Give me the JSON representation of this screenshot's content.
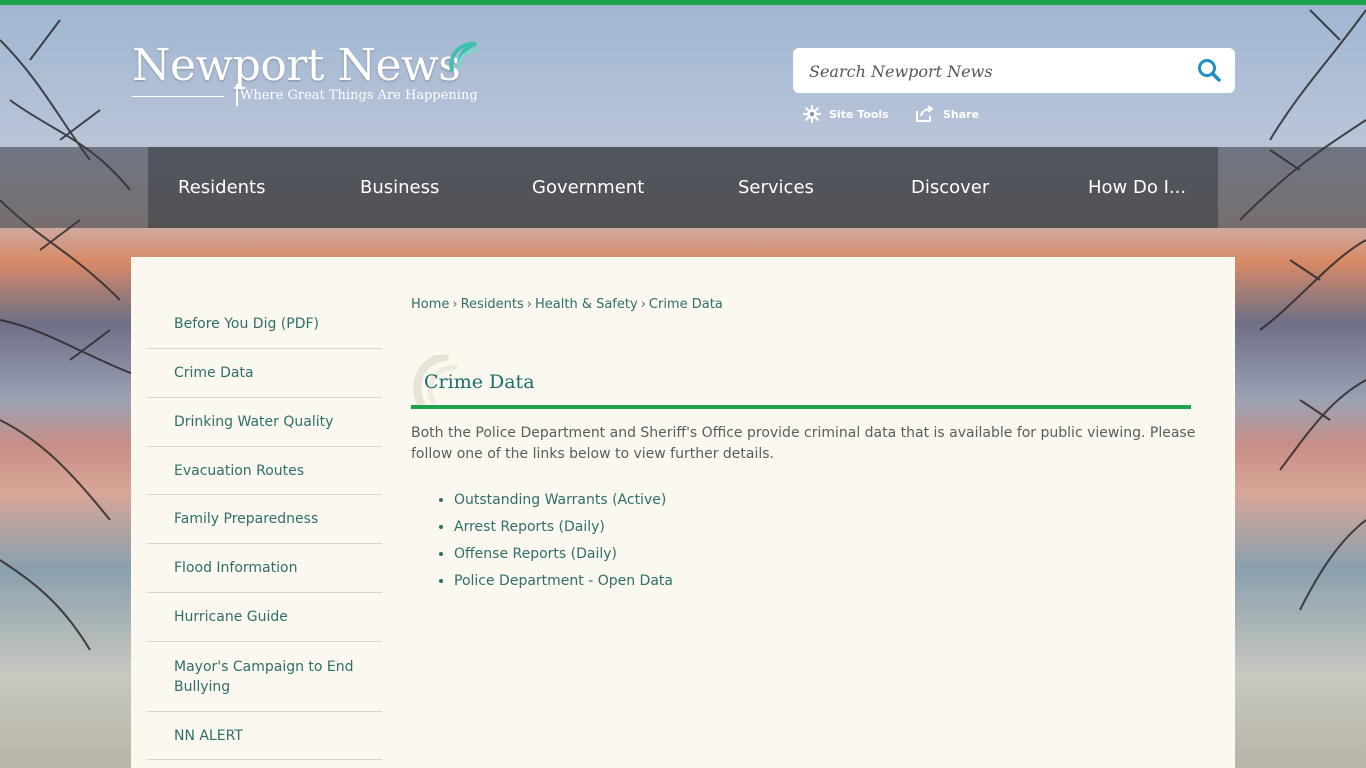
{
  "header": {
    "logo_title": "Newport News",
    "logo_tagline": "Where Great Things Are Happening",
    "search_placeholder": "Search Newport News",
    "site_tools_label": "Site Tools",
    "share_label": "Share"
  },
  "nav": {
    "items": [
      {
        "label": "Residents"
      },
      {
        "label": "Business"
      },
      {
        "label": "Government"
      },
      {
        "label": "Services"
      },
      {
        "label": "Discover"
      },
      {
        "label": "How Do I..."
      }
    ]
  },
  "sidebar": {
    "items": [
      {
        "label": "Before You Dig (PDF)"
      },
      {
        "label": "Crime Data"
      },
      {
        "label": "Drinking Water Quality"
      },
      {
        "label": "Evacuation Routes"
      },
      {
        "label": "Family Preparedness"
      },
      {
        "label": "Flood Information"
      },
      {
        "label": "Hurricane Guide"
      },
      {
        "label": "Mayor's Campaign to End Bullying"
      },
      {
        "label": "NN ALERT"
      }
    ]
  },
  "breadcrumb": {
    "items": [
      "Home",
      "Residents",
      "Health & Safety",
      "Crime Data"
    ],
    "separator": "›"
  },
  "main": {
    "title": "Crime Data",
    "intro": "Both the Police Department and Sheriff's Office provide criminal data that is available for public viewing. Please follow one of the links below to view further details.",
    "links": [
      "Outstanding Warrants (Active)",
      "Arrest Reports (Daily)",
      "Offense Reports (Daily)",
      "Police Department - Open Data"
    ]
  },
  "colors": {
    "accent_green": "#1ba34e",
    "link_teal": "#2f6f6a",
    "title_teal": "#1c6b6e",
    "search_icon_blue": "#1d8fc1"
  },
  "icons": {
    "search": "search-icon",
    "site_tools": "gear-icon",
    "share": "share-icon"
  }
}
